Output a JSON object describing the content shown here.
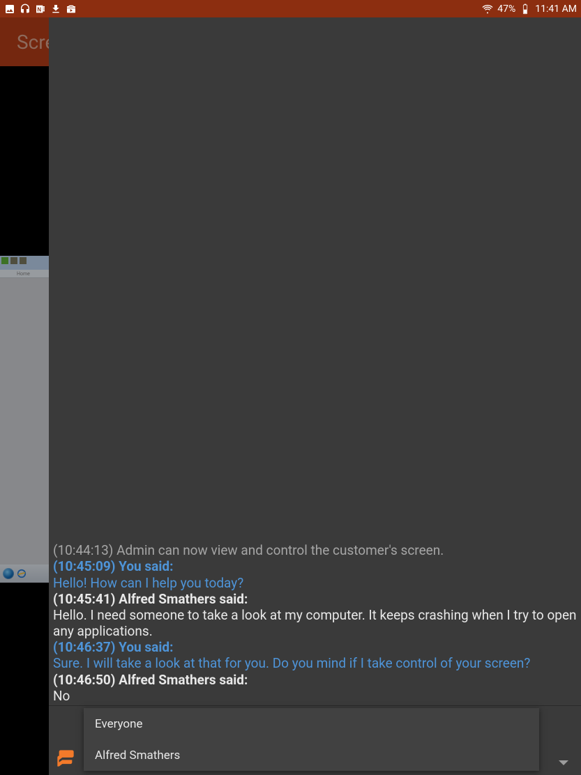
{
  "status": {
    "battery_pct": "47%",
    "time": "11:41 AM"
  },
  "app_bar": {
    "title_visible": "Scre"
  },
  "remote_preview": {
    "ribbon_tab": "Home"
  },
  "chat": {
    "system": {
      "time": "(10:44:13)",
      "text": "Admin can now view and control the customer's screen."
    },
    "messages": [
      {
        "role": "you",
        "time": "(10:45:09)",
        "header": "You said:",
        "body": "Hello! How can I help you today?"
      },
      {
        "role": "other",
        "time": "(10:45:41)",
        "header": "Alfred Smathers said:",
        "body": "Hello. I need someone to take a look at my computer. It keeps crashing when I try to open any applications."
      },
      {
        "role": "you",
        "time": "(10:46:37)",
        "header": "You said:",
        "body": "Sure. I will take a look at that for you. Do you mind if I take control of your screen?"
      },
      {
        "role": "other",
        "time": "(10:46:50)",
        "header": "Alfred Smathers said:",
        "body": "No"
      }
    ]
  },
  "recipients": {
    "options": [
      {
        "label": "Everyone"
      },
      {
        "label": "Alfred Smathers"
      }
    ]
  }
}
